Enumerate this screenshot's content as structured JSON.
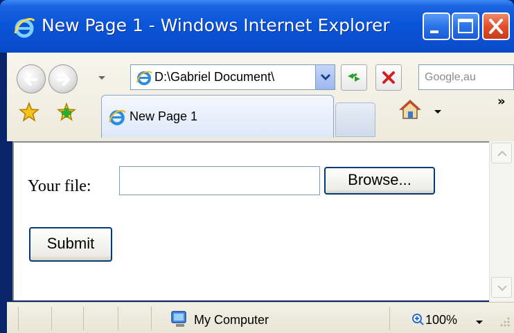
{
  "window": {
    "title": "New Page 1 - Windows Internet Explorer",
    "icon": "ie-logo-icon"
  },
  "navigation": {
    "back_icon": "back-arrow-icon",
    "forward_icon": "forward-arrow-icon",
    "address": "D:\\Gabriel Document\\",
    "refresh_icon": "refresh-icon",
    "stop_icon": "stop-icon",
    "search_placeholder": "Google,au"
  },
  "tabs": [
    {
      "label": "New Page 1",
      "active": true
    }
  ],
  "toolbar": {
    "favorites_icon": "favorites-star-icon",
    "add_favorites_icon": "add-favorites-icon",
    "home_icon": "home-icon",
    "more": "»"
  },
  "content": {
    "file_label": "Your file:",
    "file_value": "",
    "browse_label": "Browse...",
    "submit_label": "Submit"
  },
  "statusbar": {
    "zone": "My Computer",
    "zoom": "100%"
  },
  "colors": {
    "titlebar": "#0a55d8",
    "close_button": "#e0502c",
    "button_border": "#003c74"
  }
}
